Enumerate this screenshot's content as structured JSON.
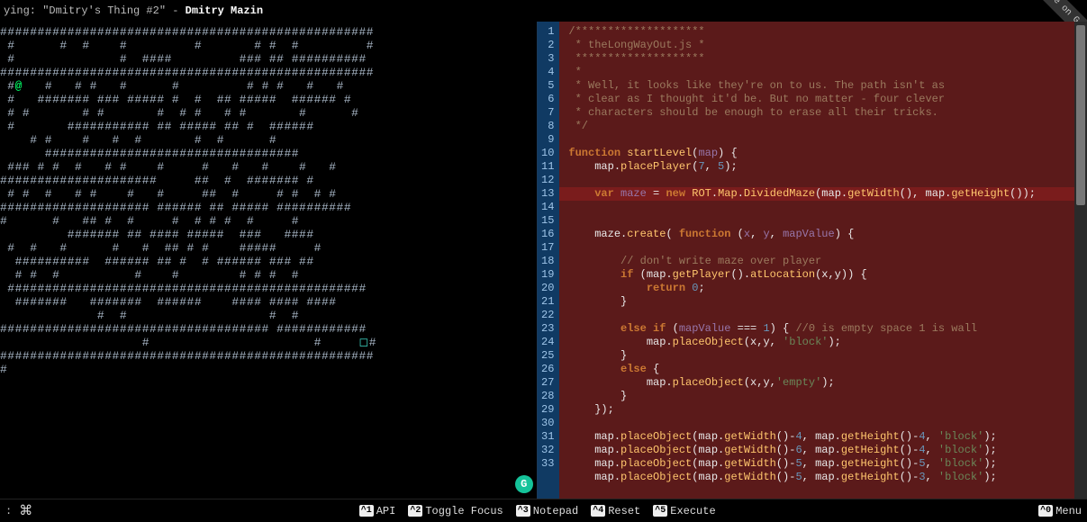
{
  "topbar": {
    "now_playing_prefix": "ying: \"Dmitry's Thing #2\" - ",
    "artist": "Dmitry Mazin"
  },
  "ribbon": "rk me on G",
  "game": {
    "player_glyph": "@",
    "exit_glyph": "◻",
    "rows": [
      "##################################################",
      " #      #  #    #         #       # #  #         #",
      " #              #  ####         ### ## ##########",
      "##################################################",
      " #@   #   # #   #      #         # # #   #   #   ",
      " #   ####### ### ##### #  #  ## #####  ###### #  ",
      " # #       # #       #  # #   # #       #      # ",
      " #       ########### ## ##### ## #  ######       ",
      "    # #    #   #  #       #  #      #            ",
      "      ##################################         ",
      " ### # #  #   # #    #     #   #   #    #   #    ",
      "#####################     ##  #  ####### #       ",
      " # #  #   # #    #   #     ##  #     # #  # #    ",
      "#################### ###### ## ##### ##########  ",
      "#      #   ## #  #     #  # # #  #     #         ",
      "         ####### ## #### #####  ###   ####       ",
      " #  #   #      #   #  ## # #    #####     #      ",
      "  ##########  ###### ## #  # ###### ### ##       ",
      "  # #  #          #    #        # # #  #         ",
      " ################################################",
      "  #######   #######  ######    #### #### ####    ",
      "             #  #                   #  #         ",
      "#################################### ############",
      "                   #                      #     ◻#",
      "##################################################",
      "#                                                "
    ]
  },
  "editor": {
    "highlight_line": 13,
    "lines": [
      {
        "n": 1,
        "raw": [
          [
            "cmt",
            "/********************"
          ]
        ]
      },
      {
        "n": 2,
        "raw": [
          [
            "cmt",
            " * theLongWayOut.js *"
          ]
        ]
      },
      {
        "n": 3,
        "raw": [
          [
            "cmt",
            " ********************"
          ]
        ]
      },
      {
        "n": 4,
        "raw": [
          [
            "cmt",
            " *"
          ]
        ]
      },
      {
        "n": 5,
        "raw": [
          [
            "cmt",
            " * Well, it looks like they're on to us. The path isn't as"
          ]
        ]
      },
      {
        "n": 6,
        "raw": [
          [
            "cmt",
            " * clear as I thought it'd be. But no matter - four clever"
          ]
        ]
      },
      {
        "n": 7,
        "raw": [
          [
            "cmt",
            " * characters should be enough to erase all their tricks."
          ]
        ]
      },
      {
        "n": 8,
        "raw": [
          [
            "cmt",
            " */"
          ]
        ]
      },
      {
        "n": 9,
        "raw": [
          [
            "plain",
            ""
          ]
        ]
      },
      {
        "n": 10,
        "raw": [
          [
            "kw",
            "function "
          ],
          [
            "fn",
            "startLevel"
          ],
          [
            "plain",
            "("
          ],
          [
            "var",
            "map"
          ],
          [
            "plain",
            ") {"
          ]
        ]
      },
      {
        "n": 11,
        "raw": [
          [
            "plain",
            "    map."
          ],
          [
            "fn",
            "placePlayer"
          ],
          [
            "plain",
            "("
          ],
          [
            "num",
            "7"
          ],
          [
            "plain",
            ", "
          ],
          [
            "num",
            "5"
          ],
          [
            "plain",
            ");"
          ]
        ]
      },
      {
        "n": 12,
        "raw": [
          [
            "plain",
            ""
          ]
        ]
      },
      {
        "n": 13,
        "raw": [
          [
            "plain",
            "    "
          ],
          [
            "kw",
            "var "
          ],
          [
            "var",
            "maze"
          ],
          [
            "plain",
            " = "
          ],
          [
            "kw",
            "new "
          ],
          [
            "type",
            "ROT"
          ],
          [
            "plain",
            "."
          ],
          [
            "type",
            "Map"
          ],
          [
            "plain",
            "."
          ],
          [
            "fn",
            "DividedMaze"
          ],
          [
            "plain",
            "(map."
          ],
          [
            "fn",
            "getWidth"
          ],
          [
            "plain",
            "(), map."
          ],
          [
            "fn",
            "getHeight"
          ],
          [
            "plain",
            "());"
          ]
        ]
      },
      {
        "n": 14,
        "raw": [
          [
            "plain",
            ""
          ]
        ]
      },
      {
        "n": 15,
        "raw": [
          [
            "plain",
            "    maze."
          ],
          [
            "fn",
            "create"
          ],
          [
            "plain",
            "( "
          ],
          [
            "kw",
            "function "
          ],
          [
            "plain",
            "("
          ],
          [
            "var",
            "x"
          ],
          [
            "plain",
            ", "
          ],
          [
            "var",
            "y"
          ],
          [
            "plain",
            ", "
          ],
          [
            "var",
            "mapValue"
          ],
          [
            "plain",
            ") {"
          ]
        ]
      },
      {
        "n": 16,
        "raw": [
          [
            "plain",
            ""
          ]
        ]
      },
      {
        "n": 17,
        "raw": [
          [
            "plain",
            "        "
          ],
          [
            "cmt",
            "// don't write maze over player"
          ]
        ]
      },
      {
        "n": 18,
        "raw": [
          [
            "plain",
            "        "
          ],
          [
            "kw",
            "if "
          ],
          [
            "plain",
            "(map."
          ],
          [
            "fn",
            "getPlayer"
          ],
          [
            "plain",
            "()."
          ],
          [
            "fn",
            "atLocation"
          ],
          [
            "plain",
            "(x,y)) {"
          ]
        ]
      },
      {
        "n": 19,
        "raw": [
          [
            "plain",
            "            "
          ],
          [
            "kw",
            "return "
          ],
          [
            "num",
            "0"
          ],
          [
            "plain",
            ";"
          ]
        ]
      },
      {
        "n": 20,
        "raw": [
          [
            "plain",
            "        }"
          ]
        ]
      },
      {
        "n": 21,
        "raw": [
          [
            "plain",
            ""
          ]
        ]
      },
      {
        "n": 22,
        "raw": [
          [
            "plain",
            "        "
          ],
          [
            "kw",
            "else if "
          ],
          [
            "plain",
            "("
          ],
          [
            "var",
            "mapValue"
          ],
          [
            "plain",
            " === "
          ],
          [
            "num",
            "1"
          ],
          [
            "plain",
            ") { "
          ],
          [
            "cmt",
            "//0 is empty space 1 is wall"
          ]
        ]
      },
      {
        "n": 23,
        "raw": [
          [
            "plain",
            "            map."
          ],
          [
            "fn",
            "placeObject"
          ],
          [
            "plain",
            "(x,y, "
          ],
          [
            "str",
            "'block'"
          ],
          [
            "plain",
            ");"
          ]
        ]
      },
      {
        "n": 24,
        "raw": [
          [
            "plain",
            "        }"
          ]
        ]
      },
      {
        "n": 25,
        "raw": [
          [
            "plain",
            "        "
          ],
          [
            "kw",
            "else "
          ],
          [
            "plain",
            "{"
          ]
        ]
      },
      {
        "n": 26,
        "raw": [
          [
            "plain",
            "            map."
          ],
          [
            "fn",
            "placeObject"
          ],
          [
            "plain",
            "(x,y,"
          ],
          [
            "str",
            "'empty'"
          ],
          [
            "plain",
            ");"
          ]
        ]
      },
      {
        "n": 27,
        "raw": [
          [
            "plain",
            "        }"
          ]
        ]
      },
      {
        "n": 28,
        "raw": [
          [
            "plain",
            "    });"
          ]
        ]
      },
      {
        "n": 29,
        "raw": [
          [
            "plain",
            ""
          ]
        ]
      },
      {
        "n": 30,
        "raw": [
          [
            "plain",
            "    map."
          ],
          [
            "fn",
            "placeObject"
          ],
          [
            "plain",
            "(map."
          ],
          [
            "fn",
            "getWidth"
          ],
          [
            "plain",
            "()-"
          ],
          [
            "num",
            "4"
          ],
          [
            "plain",
            ", map."
          ],
          [
            "fn",
            "getHeight"
          ],
          [
            "plain",
            "()-"
          ],
          [
            "num",
            "4"
          ],
          [
            "plain",
            ", "
          ],
          [
            "str",
            "'block'"
          ],
          [
            "plain",
            ");"
          ]
        ]
      },
      {
        "n": 31,
        "raw": [
          [
            "plain",
            "    map."
          ],
          [
            "fn",
            "placeObject"
          ],
          [
            "plain",
            "(map."
          ],
          [
            "fn",
            "getWidth"
          ],
          [
            "plain",
            "()-"
          ],
          [
            "num",
            "6"
          ],
          [
            "plain",
            ", map."
          ],
          [
            "fn",
            "getHeight"
          ],
          [
            "plain",
            "()-"
          ],
          [
            "num",
            "4"
          ],
          [
            "plain",
            ", "
          ],
          [
            "str",
            "'block'"
          ],
          [
            "plain",
            ");"
          ]
        ]
      },
      {
        "n": 32,
        "raw": [
          [
            "plain",
            "    map."
          ],
          [
            "fn",
            "placeObject"
          ],
          [
            "plain",
            "(map."
          ],
          [
            "fn",
            "getWidth"
          ],
          [
            "plain",
            "()-"
          ],
          [
            "num",
            "5"
          ],
          [
            "plain",
            ", map."
          ],
          [
            "fn",
            "getHeight"
          ],
          [
            "plain",
            "()-"
          ],
          [
            "num",
            "5"
          ],
          [
            "plain",
            ", "
          ],
          [
            "str",
            "'block'"
          ],
          [
            "plain",
            ");"
          ]
        ]
      },
      {
        "n": 33,
        "raw": [
          [
            "plain",
            "    map."
          ],
          [
            "fn",
            "placeObject"
          ],
          [
            "plain",
            "(map."
          ],
          [
            "fn",
            "getWidth"
          ],
          [
            "plain",
            "()-"
          ],
          [
            "num",
            "5"
          ],
          [
            "plain",
            ", map."
          ],
          [
            "fn",
            "getHeight"
          ],
          [
            "plain",
            "()-"
          ],
          [
            "num",
            "3"
          ],
          [
            "plain",
            ", "
          ],
          [
            "str",
            "'block'"
          ],
          [
            "plain",
            ");"
          ]
        ]
      }
    ]
  },
  "status": {
    "prompt": ":",
    "cmd_glyph": "⌘",
    "items": [
      {
        "key": "^1",
        "label": "API"
      },
      {
        "key": "^2",
        "label": "Toggle Focus"
      },
      {
        "key": "^3",
        "label": "Notepad"
      },
      {
        "key": "^4",
        "label": "Reset"
      },
      {
        "key": "^5",
        "label": "Execute"
      }
    ],
    "menu": {
      "key": "^0",
      "label": "Menu"
    }
  }
}
